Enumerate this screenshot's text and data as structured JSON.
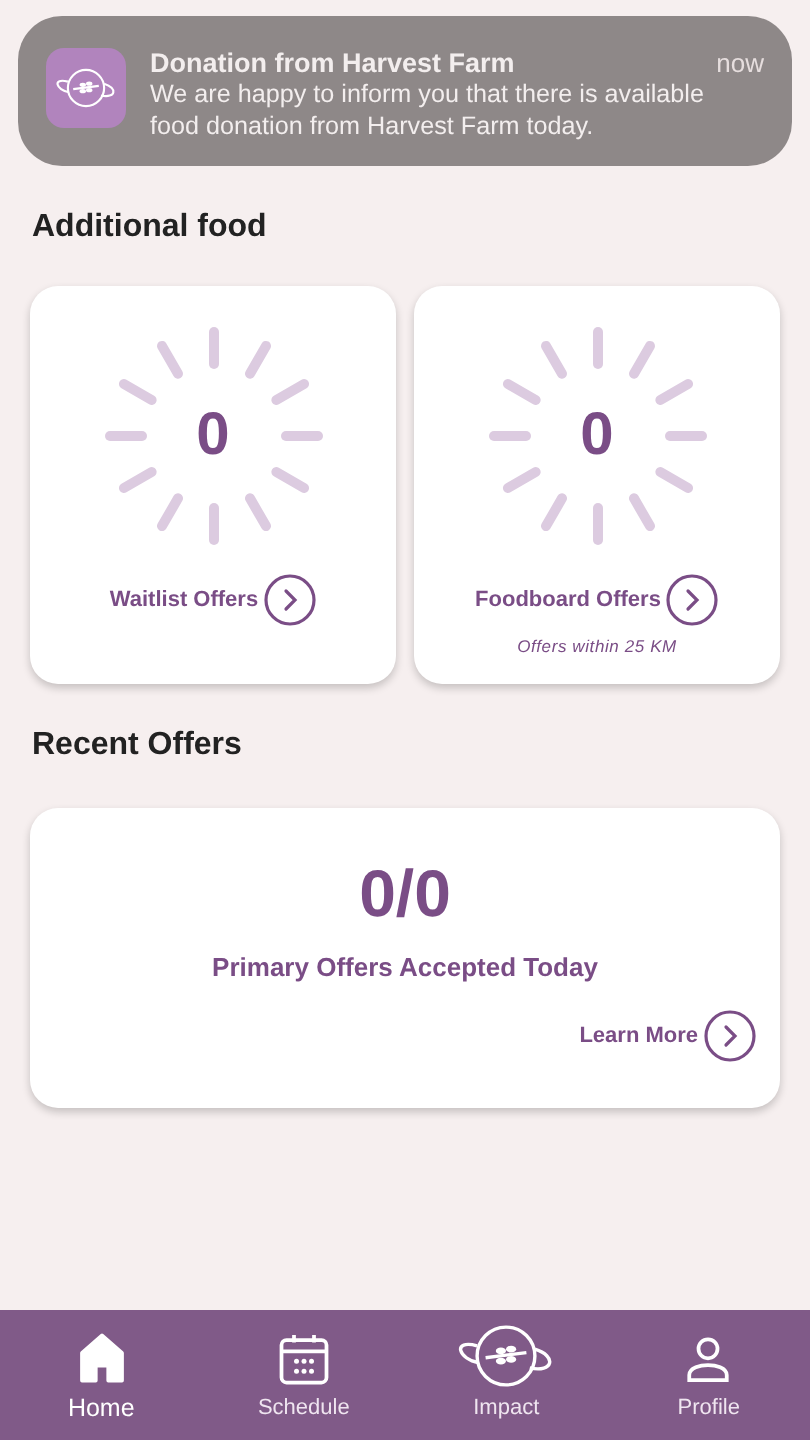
{
  "notification": {
    "title": "Donation from Harvest Farm",
    "time": "now",
    "message": "We are happy to inform you that there is available food donation from Harvest Farm today."
  },
  "additional_food": {
    "heading": "Additional food",
    "cards": [
      {
        "count": "0",
        "link": "Waitlist Offers"
      },
      {
        "count": "0",
        "link": "Foodboard Offers",
        "note": "Offers within 25 KM"
      }
    ]
  },
  "recent_offers": {
    "heading": "Recent Offers",
    "count": "0/0",
    "label": "Primary Offers Accepted Today",
    "link": "Learn More"
  },
  "nav": [
    {
      "label": "Home",
      "kind": "home",
      "selected": true
    },
    {
      "label": "Schedule",
      "kind": "schedule",
      "selected": false
    },
    {
      "label": "Impact",
      "kind": "impact",
      "selected": false
    },
    {
      "label": "Profile",
      "kind": "profile",
      "selected": false
    }
  ]
}
